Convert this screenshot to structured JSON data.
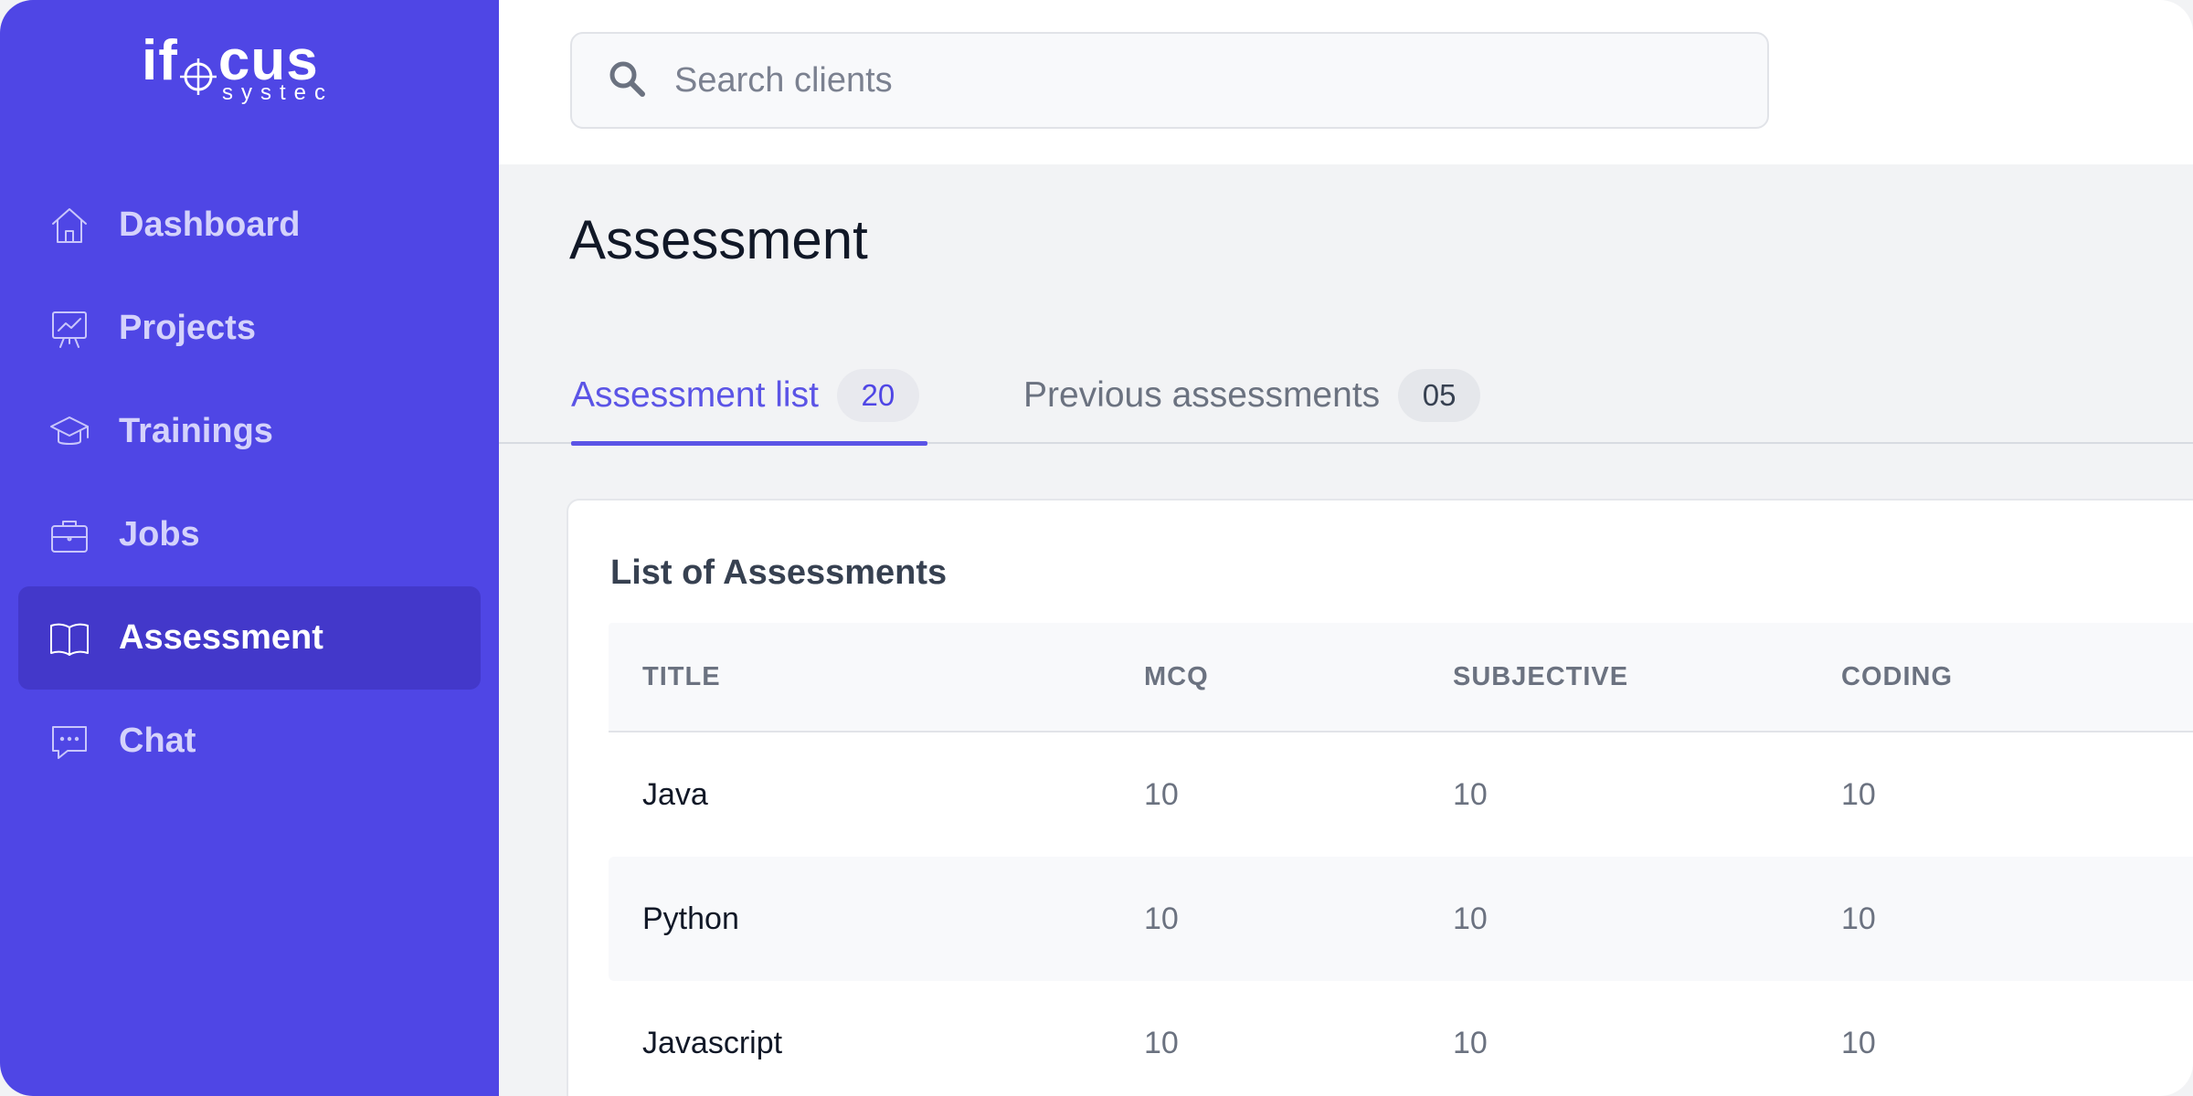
{
  "logo": {
    "main_left": "if",
    "main_right": "cus",
    "sub": "systec"
  },
  "sidebar": {
    "items": [
      {
        "label": "Dashboard",
        "icon": "home-icon"
      },
      {
        "label": "Projects",
        "icon": "presentation-chart-icon"
      },
      {
        "label": "Trainings",
        "icon": "graduation-cap-icon"
      },
      {
        "label": "Jobs",
        "icon": "briefcase-icon"
      },
      {
        "label": "Assessment",
        "icon": "open-book-icon",
        "active": true
      },
      {
        "label": "Chat",
        "icon": "chat-bubble-icon"
      }
    ]
  },
  "search": {
    "placeholder": "Search clients",
    "value": ""
  },
  "page": {
    "title": "Assessment"
  },
  "tabs": [
    {
      "label": "Assessment list",
      "count": "20",
      "active": true
    },
    {
      "label": "Previous assessments",
      "count": "05",
      "active": false
    }
  ],
  "card": {
    "title": "List of Assessments",
    "columns": [
      "TITLE",
      "MCQ",
      "SUBJECTIVE",
      "CODING"
    ],
    "rows": [
      {
        "title": "Java",
        "mcq": "10",
        "subjective": "10",
        "coding": "10"
      },
      {
        "title": "Python",
        "mcq": "10",
        "subjective": "10",
        "coding": "10"
      },
      {
        "title": "Javascript",
        "mcq": "10",
        "subjective": "10",
        "coding": "10"
      }
    ]
  },
  "colors": {
    "sidebar": "#4f46e5",
    "sidebar_active": "#4338ca",
    "accent": "#5b54e6",
    "page_bg": "#f2f3f5"
  }
}
